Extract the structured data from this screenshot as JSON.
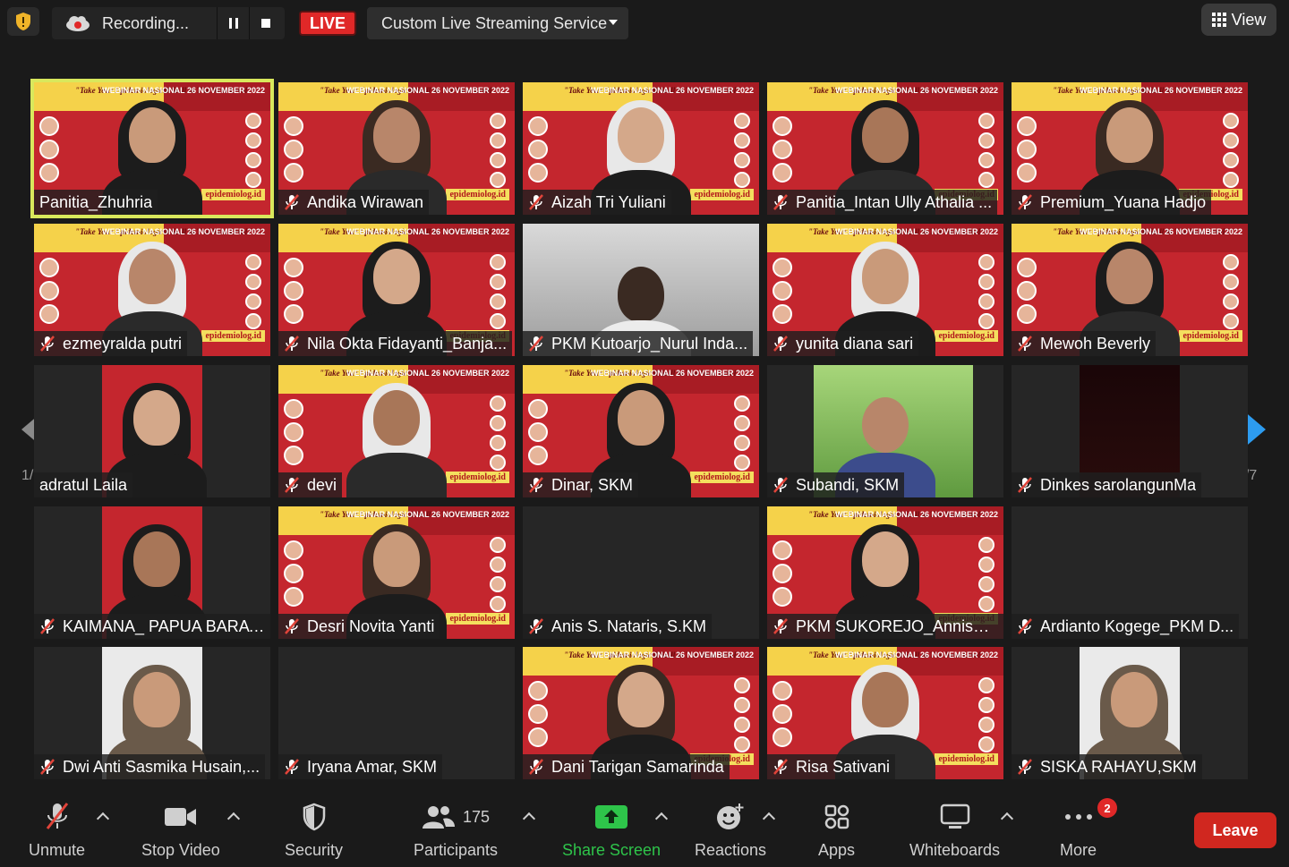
{
  "topbar": {
    "recording_label": "Recording...",
    "live_label": "LIVE",
    "stream_label": "Custom Live Streaming Service",
    "view_label": "View"
  },
  "participants": [
    {
      "name": "Panitia_Zhuhria",
      "muted": false,
      "active": true,
      "video": "banner"
    },
    {
      "name": "Andika Wirawan",
      "muted": true,
      "video": "banner"
    },
    {
      "name": "Aizah Tri Yuliani",
      "muted": true,
      "video": "banner"
    },
    {
      "name": "Panitia_Intan Ully Athalia ...",
      "muted": true,
      "video": "banner"
    },
    {
      "name": "Premium_Yuana Hadjo",
      "muted": true,
      "video": "banner"
    },
    {
      "name": "ezmeyralda putri",
      "muted": true,
      "video": "banner"
    },
    {
      "name": "Nila Okta Fidayanti_Banja...",
      "muted": true,
      "video": "banner"
    },
    {
      "name": "PKM Kutoarjo_Nurul Inda...",
      "muted": true,
      "video": "room"
    },
    {
      "name": "yunita diana sari",
      "muted": true,
      "video": "banner"
    },
    {
      "name": "Mewoh Beverly",
      "muted": true,
      "video": "banner"
    },
    {
      "name": "adratul Laila",
      "muted": false,
      "video": "narrow"
    },
    {
      "name": "devi",
      "muted": true,
      "video": "banner"
    },
    {
      "name": "Dinar, SKM",
      "muted": true,
      "video": "banner"
    },
    {
      "name": "Subandi, SKM",
      "muted": true,
      "video": "green"
    },
    {
      "name": "Dinkes sarolangunMa",
      "muted": true,
      "video": "dark"
    },
    {
      "name": "KAIMANA_ PAPUA BARAT...",
      "muted": true,
      "video": "narrow"
    },
    {
      "name": "Desri Novita Yanti",
      "muted": true,
      "video": "banner"
    },
    {
      "name": "Anis S. Nataris, S.KM",
      "muted": true,
      "video": "off"
    },
    {
      "name": "PKM SUKOREJO_Annisa R...",
      "muted": true,
      "video": "banner"
    },
    {
      "name": "Ardianto Kogege_PKM D...",
      "muted": true,
      "video": "off"
    },
    {
      "name": "Dwi Anti Sasmika Husain,...",
      "muted": true,
      "video": "narrow-white"
    },
    {
      "name": "Iryana Amar, SKM",
      "muted": true,
      "video": "off"
    },
    {
      "name": "Dani Tarigan Samarinda",
      "muted": true,
      "video": "banner"
    },
    {
      "name": "Risa Sativani",
      "muted": true,
      "video": "banner"
    },
    {
      "name": "SISKA RAHAYU,SKM",
      "muted": true,
      "video": "narrow-white"
    }
  ],
  "banner": {
    "tagline": "\"Take Your Epidemiological Skill to The Next Level\"",
    "event": "WEBINAR NASIONAL 26 NOVEMBER 2022",
    "site": "epidemiolog.id"
  },
  "pager": {
    "left": "1/7",
    "right": "1/7"
  },
  "toolbar": {
    "unmute": "Unmute",
    "stop_video": "Stop Video",
    "security": "Security",
    "participants_label": "Participants",
    "participants_count": "175",
    "share_screen": "Share Screen",
    "reactions": "Reactions",
    "apps": "Apps",
    "whiteboards": "Whiteboards",
    "more": "More",
    "more_badge": "2",
    "leave": "Leave"
  },
  "colors": {
    "share_green": "#2ec44a",
    "leave_red": "#d0271f",
    "active_outline": "#d9e85c",
    "mute_red": "#e0443a"
  }
}
